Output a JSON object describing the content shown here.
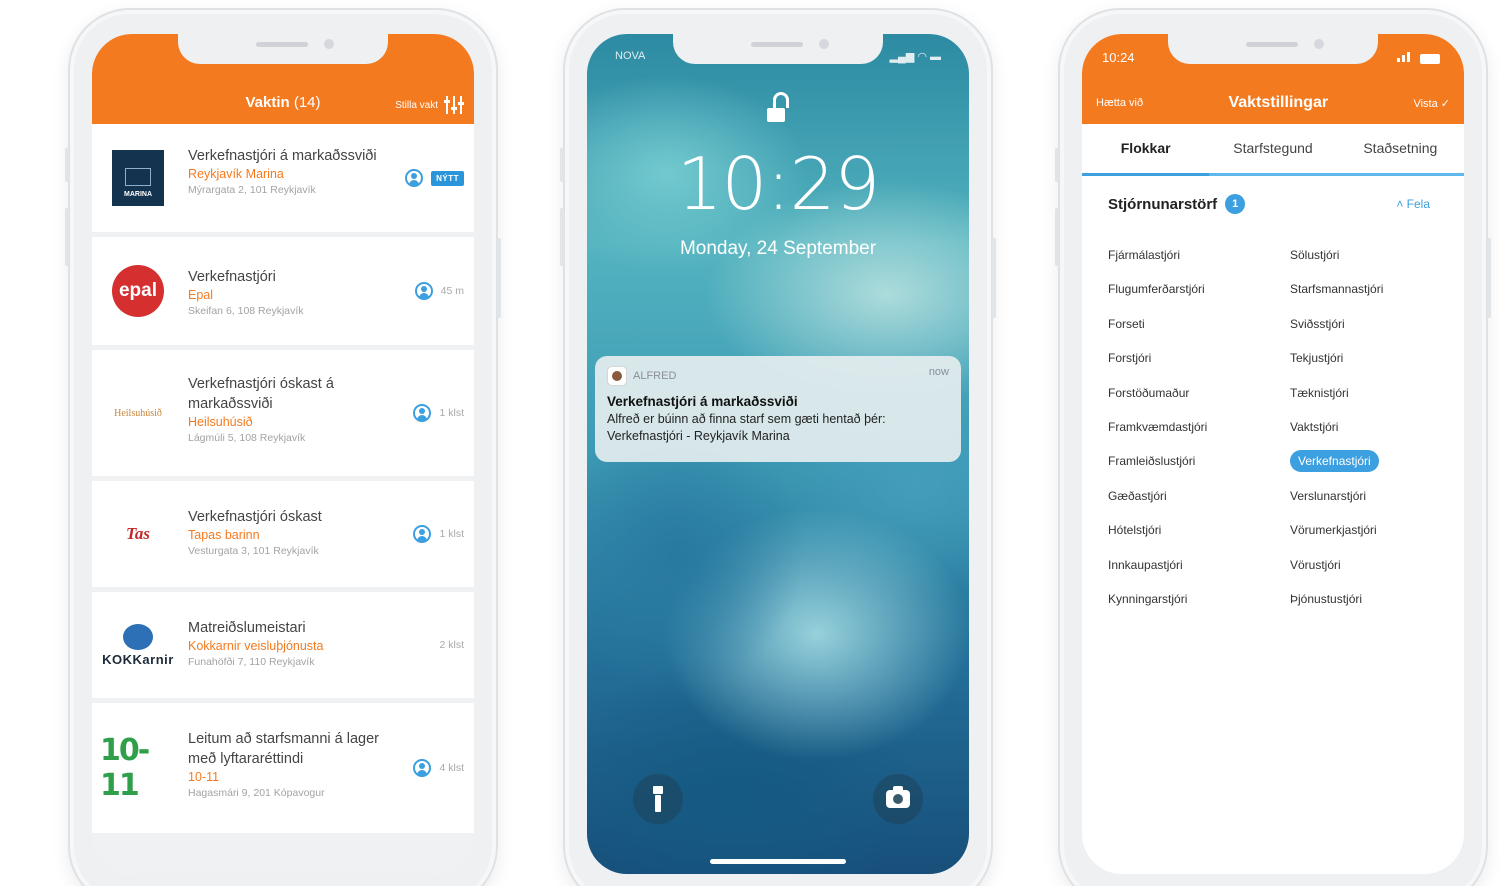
{
  "phone1": {
    "header": {
      "title": "Vaktin",
      "count": "(14)",
      "settings_label": "Stilla vakt",
      "settings_icon": "sliders-icon"
    },
    "jobs": [
      {
        "title": "Verkefnastjóri á markaðssviði",
        "company": "Reykjavík Marina",
        "address": "Mýrargata 2, 101 Reykjavík",
        "logo_text": "MARINA",
        "meta": "",
        "badge": "NÝTT"
      },
      {
        "title": "Verkefnastjóri",
        "company": "Epal",
        "address": "Skeifan 6, 108 Reykjavík",
        "logo_text": "epal",
        "meta": "45 m",
        "badge": ""
      },
      {
        "title": "Verkefnastjóri óskast á markaðssviði",
        "company": "Heilsuhúsið",
        "address": "Lágmúli 5, 108 Reykjavík",
        "logo_text": "Heilsuhúsið",
        "meta": "1 klst",
        "badge": ""
      },
      {
        "title": "Verkefnastjóri óskast",
        "company": "Tapas barinn",
        "address": "Vesturgata 3, 101 Reykjavík",
        "logo_text": "Tas",
        "meta": "1 klst",
        "badge": ""
      },
      {
        "title": "Matreiðslumeistari",
        "company": "Kokkarnir veisluþjónusta",
        "address": "Funahöfði 7, 110 Reykjavík",
        "logo_text": "KOKKarnir",
        "meta": "2 klst",
        "badge": ""
      },
      {
        "title": "Leitum að starfsmanni á lager með lyftararéttindi",
        "company": "10-11",
        "address": "Hagasmári 9, 201 Kópavogur",
        "logo_text": "10-11",
        "meta": "4 klst",
        "badge": ""
      }
    ]
  },
  "phone2": {
    "status": {
      "carrier": "NOVA"
    },
    "time": "10:29",
    "date": "Monday, 24 September",
    "notification": {
      "app": "ALFRED",
      "when": "now",
      "title": "Verkefnastjóri á markaðssviði",
      "body": "Alfreð er búinn að finna starf sem gæti hentað þér: Verkefnastjóri - Reykjavík Marina"
    }
  },
  "phone3": {
    "status": {
      "time": "10:24"
    },
    "nav": {
      "cancel": "Hætta við",
      "title": "Vaktstillingar",
      "save": "Vista"
    },
    "tabs": [
      "Flokkar",
      "Starfstegund",
      "Staðsetning"
    ],
    "section": {
      "name": "Stjórnunarstörf",
      "count": "1",
      "hide_label": "Fela"
    },
    "categories_left": [
      "Fjármálastjóri",
      "Flugumferðarstjóri",
      "Forseti",
      "Forstjóri",
      "Forstöðumaður",
      "Framkvæmdastjóri",
      "Framleiðslustjóri",
      "Gæðastjóri",
      "Hótelstjóri",
      "Innkaupastjóri",
      "Kynningarstjóri"
    ],
    "categories_right": [
      "Sölustjóri",
      "Starfsmannastjóri",
      "Sviðsstjóri",
      "Tekjustjóri",
      "Tæknistjóri",
      "Vaktstjóri",
      "Verkefnastjóri",
      "Verslunarstjóri",
      "Vörumerkjastjóri",
      "Vörustjóri",
      "Þjónustustjóri"
    ],
    "selected": "Verkefnastjóri"
  },
  "colors": {
    "accent_orange": "#f47a1f",
    "accent_blue": "#3b9fe0"
  }
}
